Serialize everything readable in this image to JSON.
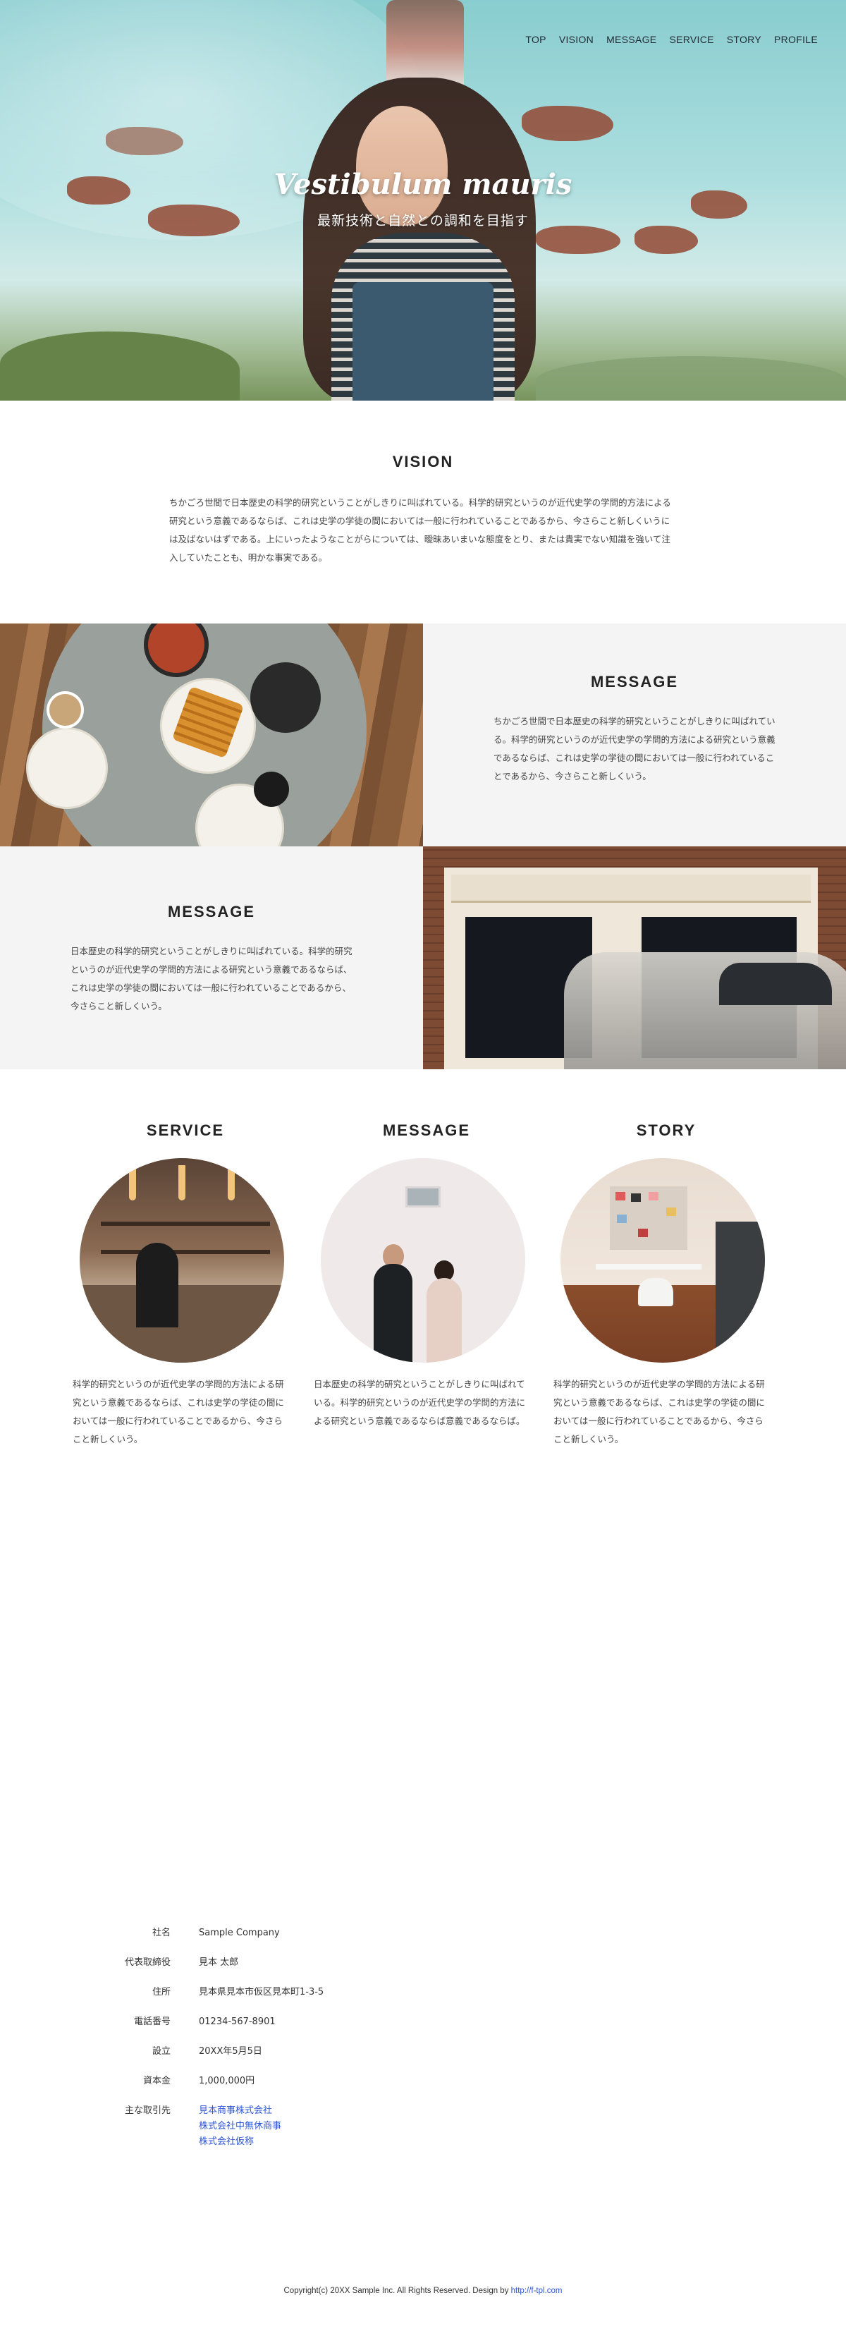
{
  "nav": {
    "items": [
      "TOP",
      "VISION",
      "MESSAGE",
      "SERVICE",
      "STORY",
      "PROFILE"
    ]
  },
  "hero": {
    "title": "Vestibulum mauris",
    "subtitle": "最新技術と自然との調和を目指す"
  },
  "vision": {
    "title": "VISION",
    "text": "ちかごろ世間で日本歴史の科学的研究ということがしきりに叫ばれている。科学的研究というのが近代史学の学問的方法による研究という意義であるならば、これは史学の学徒の間においては一般に行われていることであるから、今さらこと新しくいうには及ばないはずである。上にいったようなことがらについては、曖昧あいまいな態度をとり、または貴実でない知識を強いて注入していたことも、明かな事実である。"
  },
  "message1": {
    "title": "MESSAGE",
    "text": "ちかごろ世間で日本歴史の科学的研究ということがしきりに叫ばれている。科学的研究というのが近代史学の学問的方法による研究という意義であるならば、これは史学の学徒の間においては一般に行われていることであるから、今さらこと新しくいう。"
  },
  "message2": {
    "title": "MESSAGE",
    "text": "日本歴史の科学的研究ということがしきりに叫ばれている。科学的研究というのが近代史学の学問的方法による研究という意義であるならば、これは史学の学徒の間においては一般に行われていることであるから、今さらこと新しくいう。"
  },
  "columns": [
    {
      "title": "SERVICE",
      "text": "科学的研究というのが近代史学の学問的方法による研究という意義であるならば、これは史学の学徒の間においては一般に行われていることであるから、今さらこと新しくいう。"
    },
    {
      "title": "MESSAGE",
      "text": "日本歴史の科学的研究ということがしきりに叫ばれている。科学的研究というのが近代史学の学問的方法による研究という意義であるならば意義であるならば。"
    },
    {
      "title": "STORY",
      "text": "科学的研究というのが近代史学の学問的方法による研究という意義であるならば、これは史学の学徒の間においては一般に行われていることであるから、今さらこと新しくいう。"
    }
  ],
  "profile": {
    "rows": [
      {
        "key": "社名",
        "value": "Sample Company"
      },
      {
        "key": "代表取締役",
        "value": "見本 太郎"
      },
      {
        "key": "住所",
        "value": "見本県見本市仮区見本町1-3-5"
      },
      {
        "key": "電話番号",
        "value": "01234-567-8901"
      },
      {
        "key": "設立",
        "value": "20XX年5月5日"
      },
      {
        "key": "資本金",
        "value": "1,000,000円"
      }
    ],
    "partners_key": "主な取引先",
    "partners": [
      "見本商事株式会社",
      "株式会社中無休商事",
      "株式会社仮称"
    ]
  },
  "footer": {
    "copyright": "Copyright(c) 20XX Sample Inc. All Rights Reserved. Design by ",
    "link": "http://f-tpl.com"
  },
  "colors": {
    "link": "#2f55d4",
    "panel_bg": "#f4f4f4"
  }
}
